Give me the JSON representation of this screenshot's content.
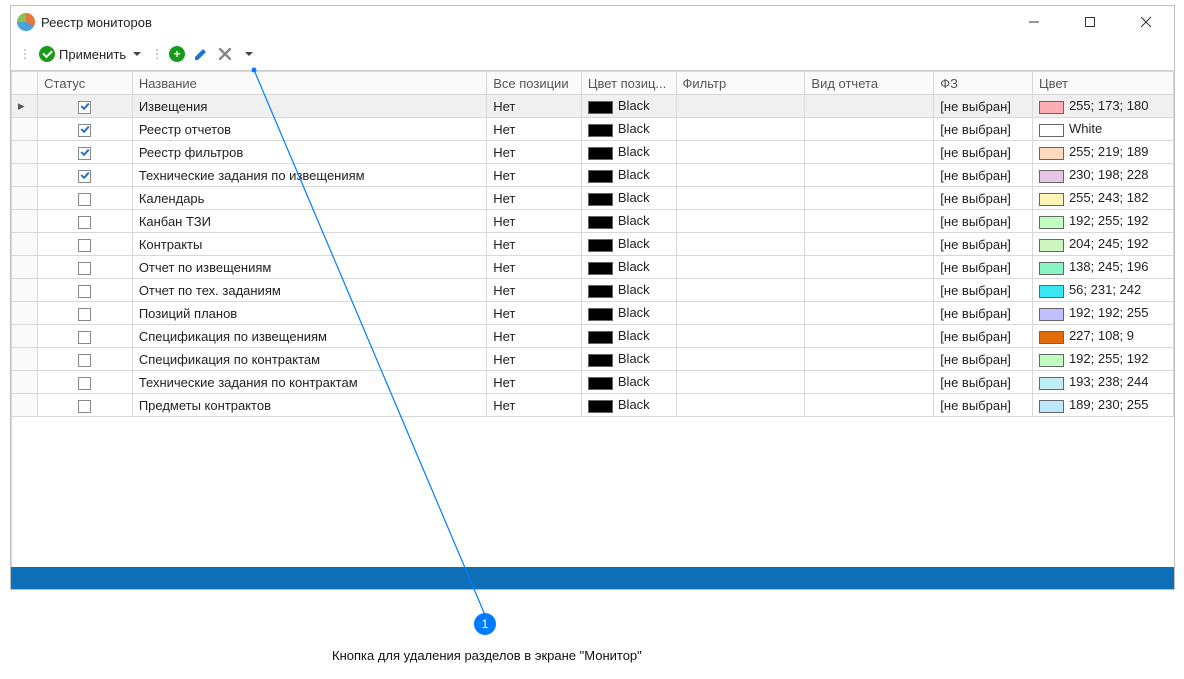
{
  "window": {
    "title": "Реестр мониторов"
  },
  "toolbar": {
    "apply_label": "Применить"
  },
  "columns": {
    "status": "Статус",
    "name": "Название",
    "all_positions": "Все позиции",
    "pos_color": "Цвет позиц...",
    "filter": "Фильтр",
    "report_type": "Вид отчета",
    "fz": "ФЗ",
    "color": "Цвет"
  },
  "fz_default": "[не выбран]",
  "all_positions_value": "Нет",
  "pos_color_name": "Black",
  "pos_color_hex": "#000000",
  "rows": [
    {
      "checked": true,
      "name": "Извещения",
      "color_hex": "#ffadb4",
      "color_label": "255; 173; 180",
      "selected": true
    },
    {
      "checked": true,
      "name": "Реестр отчетов",
      "color_hex": "#ffffff",
      "color_label": "White"
    },
    {
      "checked": true,
      "name": "Реестр фильтров",
      "color_hex": "#ffdbbd",
      "color_label": "255; 219; 189"
    },
    {
      "checked": true,
      "name": "Технические задания по извещениям",
      "color_hex": "#e6c6e4",
      "color_label": "230; 198; 228"
    },
    {
      "checked": false,
      "name": "Календарь",
      "color_hex": "#fff3b6",
      "color_label": "255; 243; 182"
    },
    {
      "checked": false,
      "name": "Канбан ТЗИ",
      "color_hex": "#c0ffc0",
      "color_label": "192; 255; 192"
    },
    {
      "checked": false,
      "name": "Контракты",
      "color_hex": "#ccf5c0",
      "color_label": "204; 245; 192"
    },
    {
      "checked": false,
      "name": "Отчет по извещениям",
      "color_hex": "#8af5c4",
      "color_label": "138; 245; 196"
    },
    {
      "checked": false,
      "name": "Отчет по тех. заданиям",
      "color_hex": "#38e7f2",
      "color_label": "56; 231; 242"
    },
    {
      "checked": false,
      "name": "Позиций планов",
      "color_hex": "#c0c0ff",
      "color_label": "192; 192; 255"
    },
    {
      "checked": false,
      "name": "Спецификация по извещениям",
      "color_hex": "#e36c09",
      "color_label": "227; 108; 9"
    },
    {
      "checked": false,
      "name": "Спецификация по контрактам",
      "color_hex": "#c0ffc0",
      "color_label": "192; 255; 192"
    },
    {
      "checked": false,
      "name": "Технические задания по контрактам",
      "color_hex": "#c1eef4",
      "color_label": "193; 238; 244"
    },
    {
      "checked": false,
      "name": "Предметы контрактов",
      "color_hex": "#bde6ff",
      "color_label": "189; 230; 255"
    }
  ],
  "annotation": {
    "number": "1",
    "text": "Кнопка для удаления разделов в экране \"Монитор\""
  }
}
